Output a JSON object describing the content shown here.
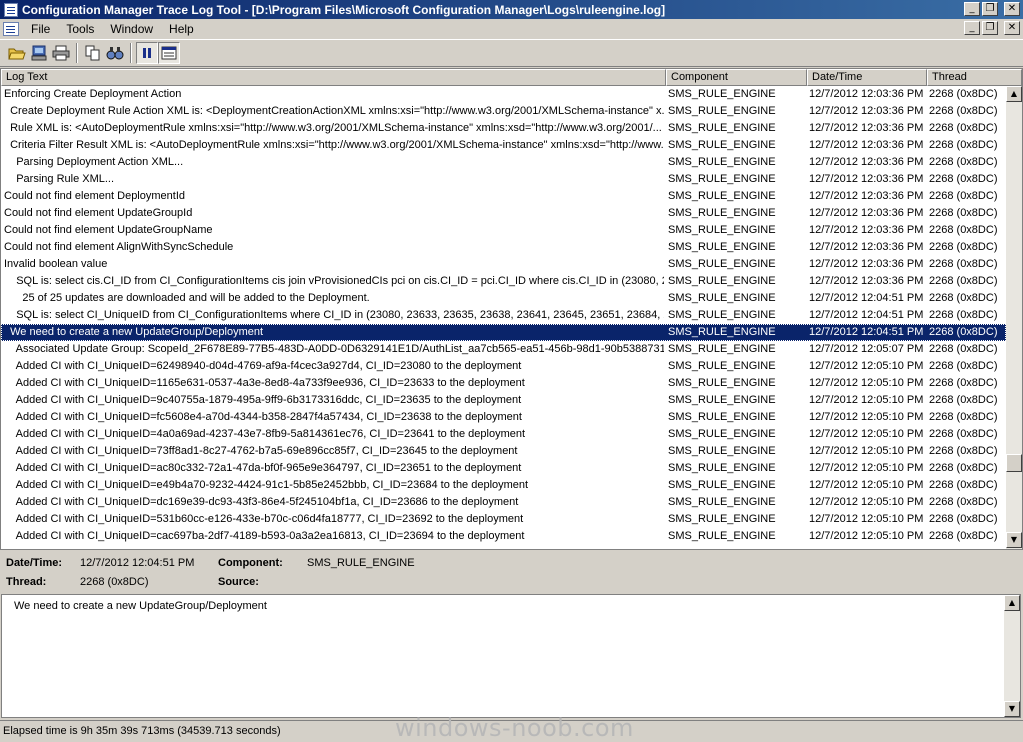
{
  "window": {
    "title": "Configuration Manager Trace Log Tool - [D:\\Program Files\\Microsoft Configuration Manager\\Logs\\ruleengine.log]"
  },
  "menu": {
    "items": [
      "File",
      "Tools",
      "Window",
      "Help"
    ]
  },
  "toolbar": {
    "buttons": [
      "open-icon",
      "open-on-server-icon",
      "print-icon",
      "copy-icon",
      "find-icon",
      "pause-icon",
      "highlight-icon"
    ]
  },
  "columns": [
    "Log Text",
    "Component",
    "Date/Time",
    "Thread"
  ],
  "rows": [
    {
      "text": "Enforcing Create Deployment Action",
      "component": "SMS_RULE_ENGINE",
      "datetime": "12/7/2012 12:03:36 PM",
      "thread": "2268 (0x8DC)"
    },
    {
      "text": "  Create Deployment Rule Action XML is: <DeploymentCreationActionXML xmlns:xsi=\"http://www.w3.org/2001/XMLSchema-instance\" x...",
      "component": "SMS_RULE_ENGINE",
      "datetime": "12/7/2012 12:03:36 PM",
      "thread": "2268 (0x8DC)"
    },
    {
      "text": "  Rule XML is: <AutoDeploymentRule xmlns:xsi=\"http://www.w3.org/2001/XMLSchema-instance\" xmlns:xsd=\"http://www.w3.org/2001/...",
      "component": "SMS_RULE_ENGINE",
      "datetime": "12/7/2012 12:03:36 PM",
      "thread": "2268 (0x8DC)"
    },
    {
      "text": "  Criteria Filter Result XML is: <AutoDeploymentRule xmlns:xsi=\"http://www.w3.org/2001/XMLSchema-instance\" xmlns:xsd=\"http://www....",
      "component": "SMS_RULE_ENGINE",
      "datetime": "12/7/2012 12:03:36 PM",
      "thread": "2268 (0x8DC)"
    },
    {
      "text": "    Parsing Deployment Action XML...",
      "component": "SMS_RULE_ENGINE",
      "datetime": "12/7/2012 12:03:36 PM",
      "thread": "2268 (0x8DC)"
    },
    {
      "text": "    Parsing Rule XML...",
      "component": "SMS_RULE_ENGINE",
      "datetime": "12/7/2012 12:03:36 PM",
      "thread": "2268 (0x8DC)"
    },
    {
      "text": "Could not find element DeploymentId",
      "component": "SMS_RULE_ENGINE",
      "datetime": "12/7/2012 12:03:36 PM",
      "thread": "2268 (0x8DC)"
    },
    {
      "text": "Could not find element UpdateGroupId",
      "component": "SMS_RULE_ENGINE",
      "datetime": "12/7/2012 12:03:36 PM",
      "thread": "2268 (0x8DC)"
    },
    {
      "text": "Could not find element UpdateGroupName",
      "component": "SMS_RULE_ENGINE",
      "datetime": "12/7/2012 12:03:36 PM",
      "thread": "2268 (0x8DC)"
    },
    {
      "text": "Could not find element AlignWithSyncSchedule",
      "component": "SMS_RULE_ENGINE",
      "datetime": "12/7/2012 12:03:36 PM",
      "thread": "2268 (0x8DC)"
    },
    {
      "text": "Invalid boolean value",
      "component": "SMS_RULE_ENGINE",
      "datetime": "12/7/2012 12:03:36 PM",
      "thread": "2268 (0x8DC)"
    },
    {
      "text": "    SQL is: select cis.CI_ID from CI_ConfigurationItems cis join vProvisionedCIs pci on cis.CI_ID = pci.CI_ID where cis.CI_ID in (23080, 23...",
      "component": "SMS_RULE_ENGINE",
      "datetime": "12/7/2012 12:03:36 PM",
      "thread": "2268 (0x8DC)"
    },
    {
      "text": "      25 of 25 updates are downloaded and will be added to the Deployment.",
      "component": "SMS_RULE_ENGINE",
      "datetime": "12/7/2012 12:04:51 PM",
      "thread": "2268 (0x8DC)"
    },
    {
      "text": "    SQL is: select CI_UniqueID from CI_ConfigurationItems where CI_ID in (23080, 23633, 23635, 23638, 23641, 23645, 23651, 23684, 2...",
      "component": "SMS_RULE_ENGINE",
      "datetime": "12/7/2012 12:04:51 PM",
      "thread": "2268 (0x8DC)"
    },
    {
      "text": "  We need to create a new UpdateGroup/Deployment",
      "component": "SMS_RULE_ENGINE",
      "datetime": "12/7/2012 12:04:51 PM",
      "thread": "2268 (0x8DC)",
      "selected": true
    },
    {
      "text": "    Associated Update Group: ScopeId_2F678E89-77B5-483D-A0DD-0D6329141E1D/AuthList_aa7cb565-ea51-456b-98d1-90b5388731...",
      "component": "SMS_RULE_ENGINE",
      "datetime": "12/7/2012 12:05:07 PM",
      "thread": "2268 (0x8DC)"
    },
    {
      "text": "    Added CI with CI_UniqueID=62498940-d04d-4769-af9a-f4cec3a927d4, CI_ID=23080 to the deployment",
      "component": "SMS_RULE_ENGINE",
      "datetime": "12/7/2012 12:05:10 PM",
      "thread": "2268 (0x8DC)"
    },
    {
      "text": "    Added CI with CI_UniqueID=1165e631-0537-4a3e-8ed8-4a733f9ee936, CI_ID=23633 to the deployment",
      "component": "SMS_RULE_ENGINE",
      "datetime": "12/7/2012 12:05:10 PM",
      "thread": "2268 (0x8DC)"
    },
    {
      "text": "    Added CI with CI_UniqueID=9c40755a-1879-495a-9ff9-6b3173316ddc, CI_ID=23635 to the deployment",
      "component": "SMS_RULE_ENGINE",
      "datetime": "12/7/2012 12:05:10 PM",
      "thread": "2268 (0x8DC)"
    },
    {
      "text": "    Added CI with CI_UniqueID=fc5608e4-a70d-4344-b358-2847f4a57434, CI_ID=23638 to the deployment",
      "component": "SMS_RULE_ENGINE",
      "datetime": "12/7/2012 12:05:10 PM",
      "thread": "2268 (0x8DC)"
    },
    {
      "text": "    Added CI with CI_UniqueID=4a0a69ad-4237-43e7-8fb9-5a814361ec76, CI_ID=23641 to the deployment",
      "component": "SMS_RULE_ENGINE",
      "datetime": "12/7/2012 12:05:10 PM",
      "thread": "2268 (0x8DC)"
    },
    {
      "text": "    Added CI with CI_UniqueID=73ff8ad1-8c27-4762-b7a5-69e896cc85f7, CI_ID=23645 to the deployment",
      "component": "SMS_RULE_ENGINE",
      "datetime": "12/7/2012 12:05:10 PM",
      "thread": "2268 (0x8DC)"
    },
    {
      "text": "    Added CI with CI_UniqueID=ac80c332-72a1-47da-bf0f-965e9e364797, CI_ID=23651 to the deployment",
      "component": "SMS_RULE_ENGINE",
      "datetime": "12/7/2012 12:05:10 PM",
      "thread": "2268 (0x8DC)"
    },
    {
      "text": "    Added CI with CI_UniqueID=e49b4a70-9232-4424-91c1-5b85e2452bbb, CI_ID=23684 to the deployment",
      "component": "SMS_RULE_ENGINE",
      "datetime": "12/7/2012 12:05:10 PM",
      "thread": "2268 (0x8DC)"
    },
    {
      "text": "    Added CI with CI_UniqueID=dc169e39-dc93-43f3-86e4-5f245104bf1a, CI_ID=23686 to the deployment",
      "component": "SMS_RULE_ENGINE",
      "datetime": "12/7/2012 12:05:10 PM",
      "thread": "2268 (0x8DC)"
    },
    {
      "text": "    Added CI with CI_UniqueID=531b60cc-e126-433e-b70c-c06d4fa18777, CI_ID=23692 to the deployment",
      "component": "SMS_RULE_ENGINE",
      "datetime": "12/7/2012 12:05:10 PM",
      "thread": "2268 (0x8DC)"
    },
    {
      "text": "    Added CI with CI_UniqueID=cac697ba-2df7-4189-b593-0a3a2ea16813, CI_ID=23694 to the deployment",
      "component": "SMS_RULE_ENGINE",
      "datetime": "12/7/2012 12:05:10 PM",
      "thread": "2268 (0x8DC)"
    }
  ],
  "detail": {
    "datetime_label": "Date/Time:",
    "datetime_value": "12/7/2012 12:04:51 PM",
    "component_label": "Component:",
    "component_value": "SMS_RULE_ENGINE",
    "thread_label": "Thread:",
    "thread_value": "2268 (0x8DC)",
    "source_label": "Source:",
    "source_value": ""
  },
  "message": "We need to create a new UpdateGroup/Deployment",
  "status": "Elapsed time is 9h 35m 39s 713ms (34539.713 seconds)",
  "watermark": "windows-noob.com",
  "colors": {
    "title_gradient_start": "#0a246a",
    "selection": "#0a246a",
    "chrome": "#d4d0c8"
  }
}
